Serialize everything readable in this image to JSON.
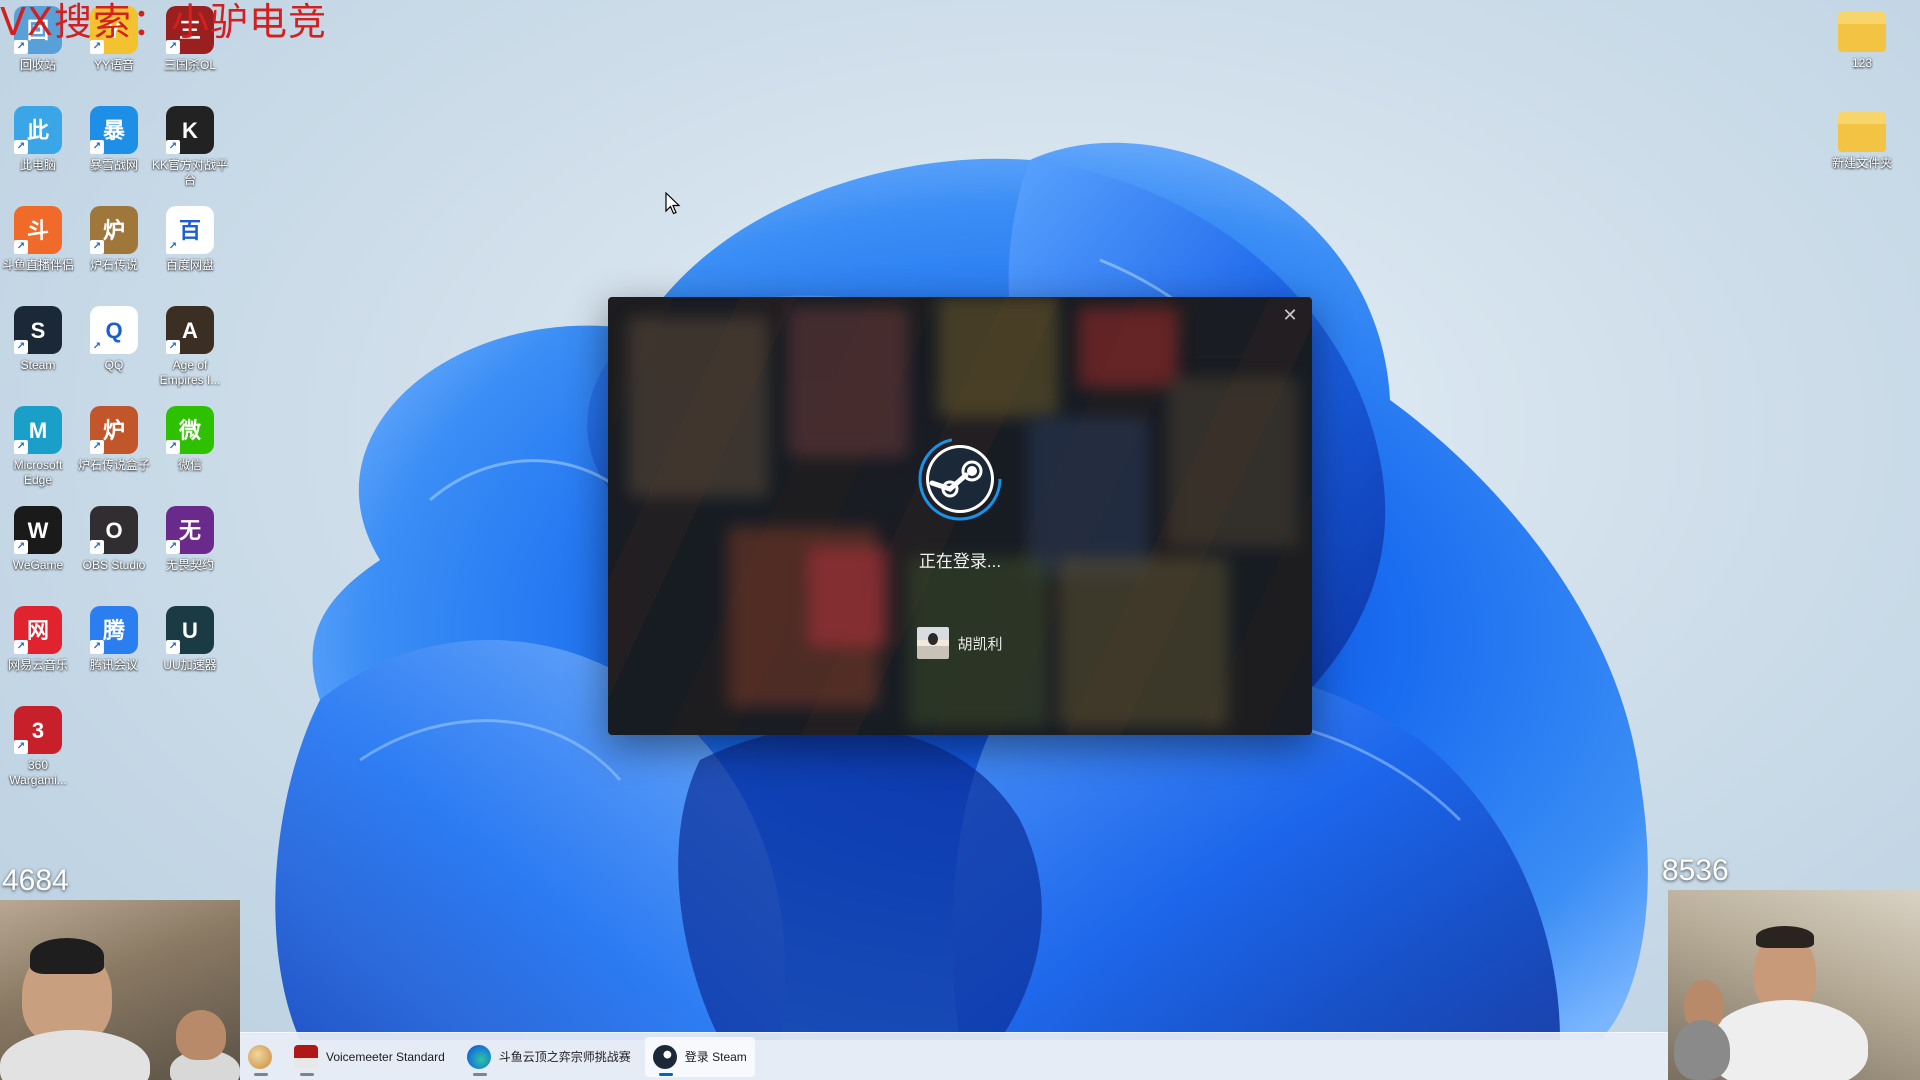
{
  "watermark": "VX搜索：小驴电竞",
  "desktop_icons_left": [
    {
      "label": "回收站",
      "icon": "recycle-bin-icon",
      "color": "#5aa0d8"
    },
    {
      "label": "YY语音",
      "icon": "yy-voice-icon",
      "color": "#f2c230"
    },
    {
      "label": "三国杀OL",
      "icon": "sanguosha-icon",
      "color": "#9a1f1f"
    },
    {
      "label": "此电脑",
      "icon": "this-pc-icon",
      "color": "#3aa6e8"
    },
    {
      "label": "暴雪战网",
      "icon": "battlenet-icon",
      "color": "#1d8fe6"
    },
    {
      "label": "KK官方对战平台",
      "icon": "kk-platform-icon",
      "color": "#222222"
    },
    {
      "label": "斗鱼直播伴侣",
      "icon": "douyu-icon",
      "color": "#f06a2a"
    },
    {
      "label": "炉石传说",
      "icon": "hearthstone-icon",
      "color": "#a0773a"
    },
    {
      "label": "百度网盘",
      "icon": "baidu-netdisk-icon",
      "color": "#ffffff"
    },
    {
      "label": "Steam",
      "icon": "steam-icon",
      "color": "#1b2838"
    },
    {
      "label": "QQ",
      "icon": "qq-icon",
      "color": "#ffffff"
    },
    {
      "label": "Age of Empires I...",
      "icon": "age-of-empires-icon",
      "color": "#3a2f22"
    },
    {
      "label": "Microsoft Edge",
      "icon": "edge-icon",
      "color": "#1aa0c8"
    },
    {
      "label": "炉石传说盒子",
      "icon": "hearthstone-box-icon",
      "color": "#c0562a"
    },
    {
      "label": "微信",
      "icon": "wechat-icon",
      "color": "#2dc100"
    },
    {
      "label": "WeGame",
      "icon": "wegame-icon",
      "color": "#1a1a1a"
    },
    {
      "label": "OBS Studio",
      "icon": "obs-icon",
      "color": "#302e31"
    },
    {
      "label": "无畏契约",
      "icon": "valorant-icon",
      "color": "#6a2a8c"
    },
    {
      "label": "网易云音乐",
      "icon": "netease-music-icon",
      "color": "#e0232e"
    },
    {
      "label": "腾讯会议",
      "icon": "tencent-meeting-icon",
      "color": "#2a7ef0"
    },
    {
      "label": "UU加速器",
      "icon": "uu-accelerator-icon",
      "color": "#1a3a44"
    },
    {
      "label": "360 Wargami...",
      "icon": "wargaming-icon",
      "color": "#c8202a"
    }
  ],
  "desktop_icons_right": [
    {
      "label": "123",
      "icon": "folder-icon",
      "color": "#f3c443"
    },
    {
      "label": "新建文件夹",
      "icon": "folder-icon",
      "color": "#f3c443"
    }
  ],
  "steam_dialog": {
    "close": "✕",
    "status": "正在登录...",
    "username": "胡凯利"
  },
  "viewer_count_left": "4684",
  "viewer_count_right": "8536",
  "taskbar": {
    "items": [
      {
        "label": "",
        "icon": "app-avatar-icon"
      },
      {
        "label": "Voicemeeter Standard",
        "icon": "voicemeeter-icon"
      },
      {
        "label": "斗鱼云顶之弈宗师挑战赛",
        "icon": "edge-icon"
      },
      {
        "label": "登录 Steam",
        "icon": "steam-icon"
      }
    ]
  }
}
